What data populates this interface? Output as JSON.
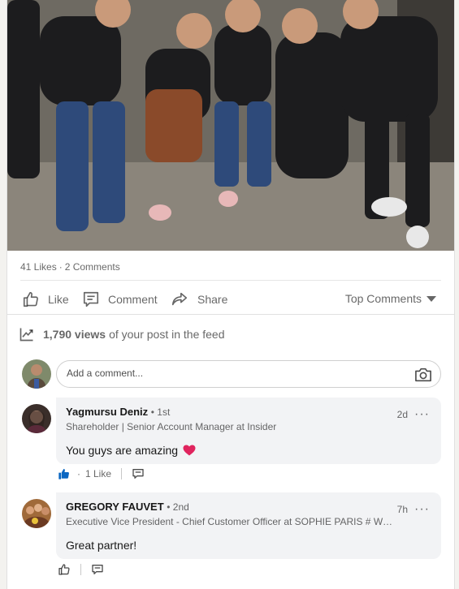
{
  "post": {
    "likes_count_text": "41 Likes",
    "comments_count_text": "2 Comments",
    "dot": "·"
  },
  "actions": {
    "like_label": "Like",
    "comment_label": "Comment",
    "share_label": "Share",
    "sort_label": "Top Comments"
  },
  "views": {
    "count": "1,790 views",
    "suffix": "of your post in the feed"
  },
  "add_comment": {
    "placeholder": "Add a comment..."
  },
  "comments": [
    {
      "name": "Yagmursu Deniz",
      "degree": "• 1st",
      "headline": "Shareholder | Senior Account Manager at Insider",
      "time": "2d",
      "more": "···",
      "text": "You guys are amazing",
      "emoji_icon": "red-heart-icon",
      "likes_text": "1 Like",
      "like_dot": "·"
    },
    {
      "name": "GREGORY FAUVET",
      "degree": "• 2nd",
      "headline": "Executive Vice President - Chief Customer Officer at SOPHIE PARIS # We a...",
      "time": "7h",
      "more": "···",
      "text": "Great partner!"
    }
  ],
  "colors": {
    "liked_blue": "#0a66c2",
    "heart_red": "#e0245e",
    "text_secondary": "rgba(0,0,0,0.6)"
  }
}
